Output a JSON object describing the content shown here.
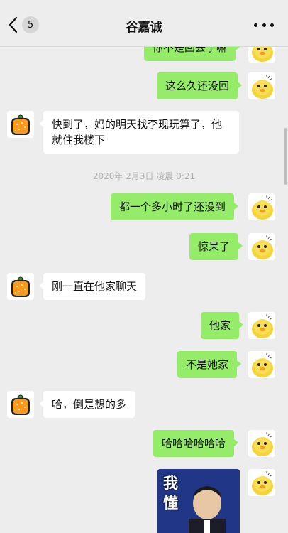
{
  "header": {
    "back_badge": "5",
    "title": "谷嘉诚"
  },
  "messages": [
    {
      "side": "right",
      "text": "你不是回去了嘛"
    },
    {
      "side": "right",
      "text": "这么久还没回"
    },
    {
      "side": "left",
      "text_lines": [
        "快到了，妈的明天找李现玩算了，他",
        "就住我楼下"
      ]
    },
    {
      "timestamp": "2020年 2月3日 凌晨 0:21"
    },
    {
      "side": "right",
      "text": "都一个多小时了还没到"
    },
    {
      "side": "right",
      "text": "惊呆了"
    },
    {
      "side": "left",
      "text": "刚一直在他家聊天"
    },
    {
      "side": "right",
      "text": "他家"
    },
    {
      "side": "right",
      "text": "不是她家"
    },
    {
      "side": "left",
      "text": "哈，倒是想的多"
    },
    {
      "side": "right",
      "text": "哈哈哈哈哈哈"
    },
    {
      "side": "right",
      "sticker_text": "我懂"
    }
  ],
  "colors": {
    "background": "#ededed",
    "outgoing_bubble": "#95ec69",
    "incoming_bubble": "#ffffff",
    "timestamp_text": "#b2b2b2"
  },
  "icons": {
    "back": "chevron-left-icon",
    "more": "more-dots-icon",
    "my_avatar": "yellow-duck-avatar",
    "contact_avatar": "orange-fruit-avatar"
  }
}
